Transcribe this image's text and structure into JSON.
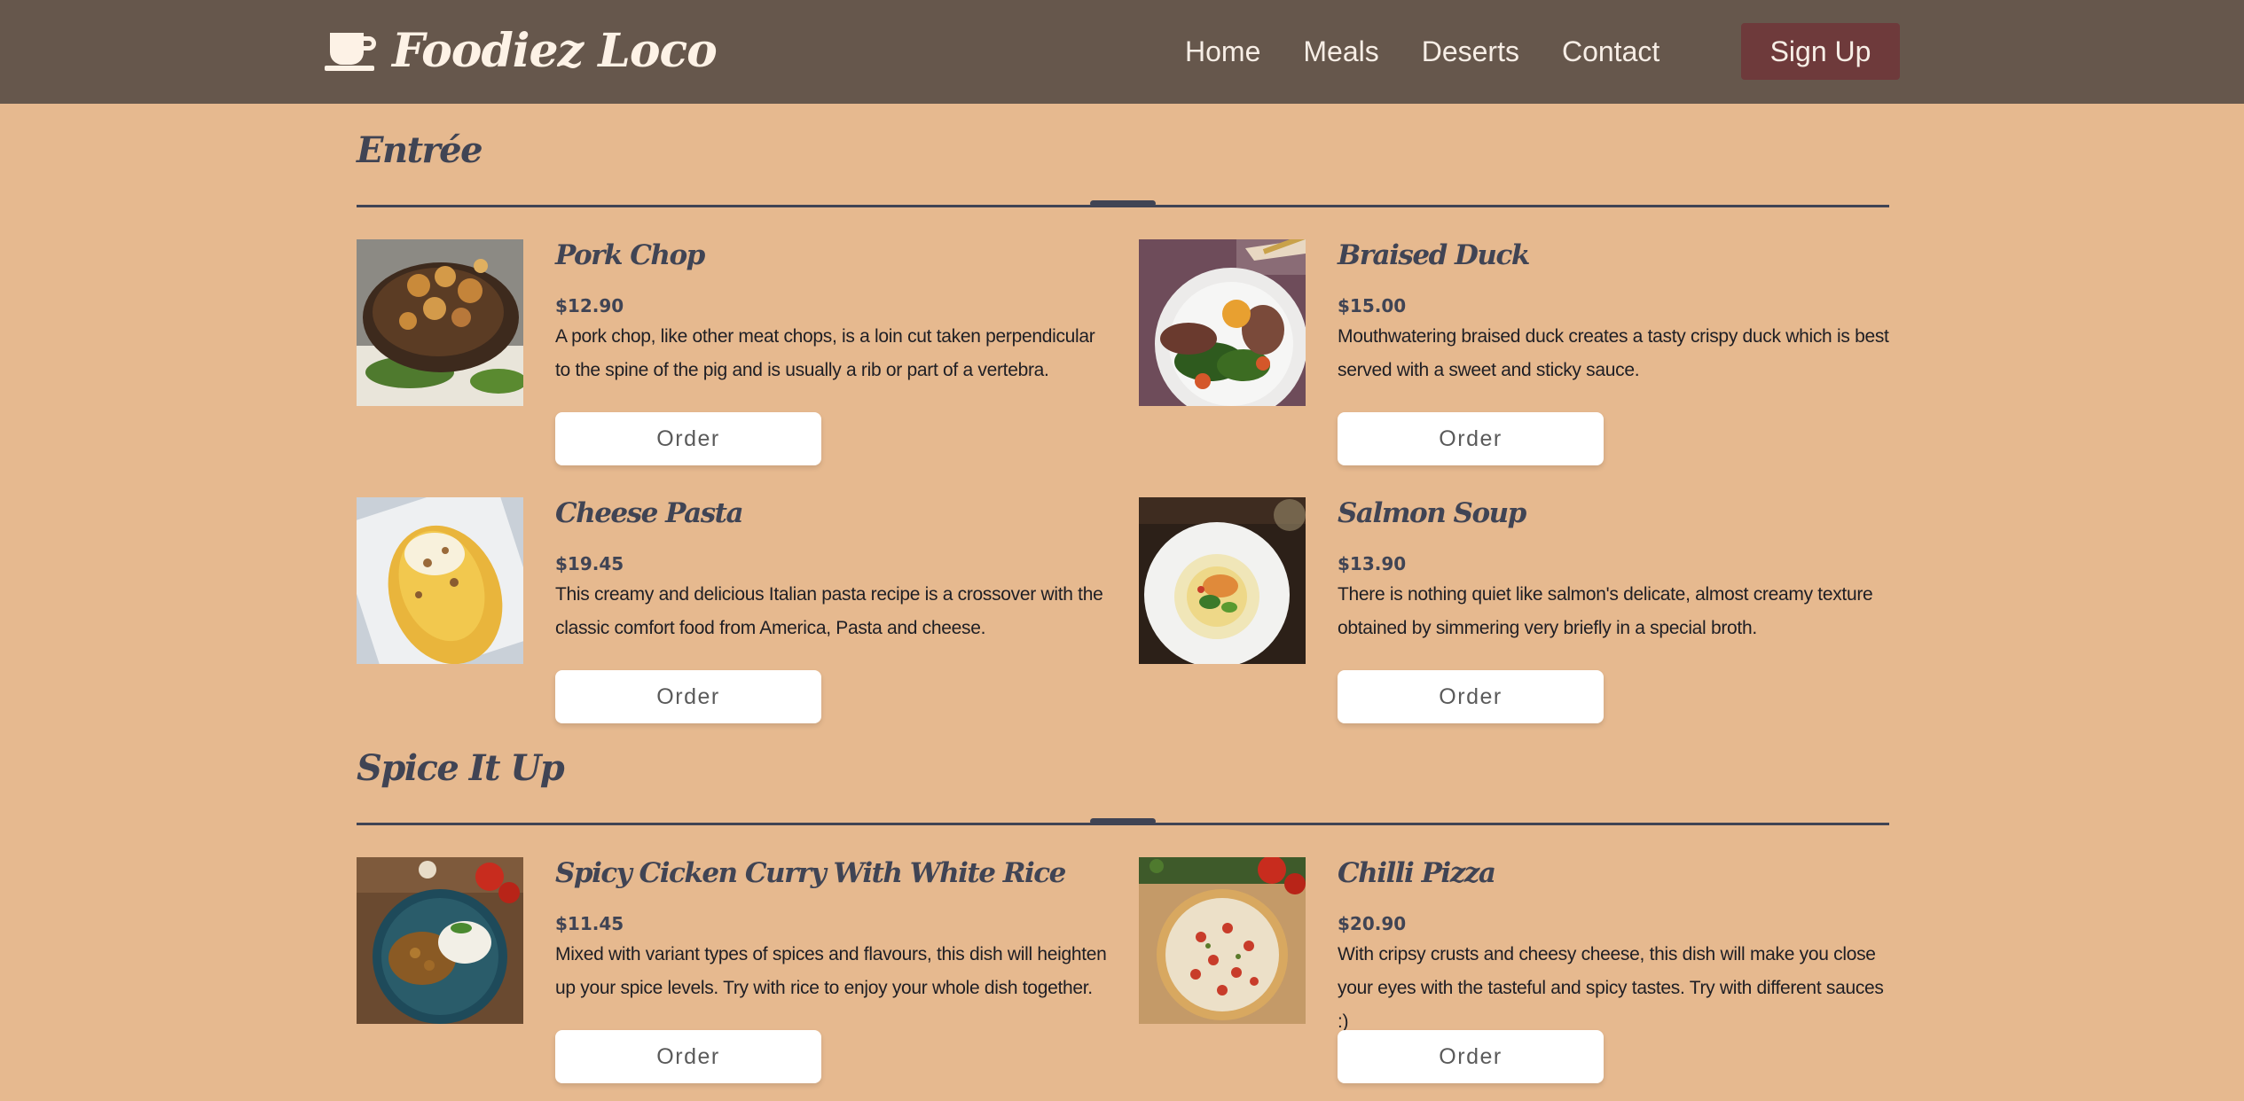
{
  "header": {
    "brand": "Foodiez Loco",
    "brand_icon": "coffee-cup-icon",
    "nav": [
      "Home",
      "Meals",
      "Deserts",
      "Contact"
    ],
    "signup_label": "Sign Up"
  },
  "colors": {
    "page_background": "#e6b98f",
    "navbar": "#66574c",
    "signup_button": "#6e3a3b",
    "heading": "#404454"
  },
  "sections": [
    {
      "title": "Entrée",
      "items": [
        {
          "name": "Pork Chop",
          "price": "$12.90",
          "description": "A pork chop, like other meat chops, is a loin cut taken perpendicular to the spine of the pig and is usually a rib or part of a vertebra.",
          "order_label": "Order"
        },
        {
          "name": "Braised Duck",
          "price": "$15.00",
          "description": "Mouthwatering braised duck creates a tasty crispy duck which is best served with a sweet and sticky sauce.",
          "order_label": "Order"
        },
        {
          "name": "Cheese Pasta",
          "price": "$19.45",
          "description": "This creamy and delicious Italian pasta recipe is a crossover with the classic comfort food from America, Pasta and cheese.",
          "order_label": "Order"
        },
        {
          "name": "Salmon Soup",
          "price": "$13.90",
          "description": "There is nothing quiet like salmon's delicate, almost creamy texture obtained by simmering very briefly in a special broth.",
          "order_label": "Order"
        }
      ]
    },
    {
      "title": "Spice It Up",
      "items": [
        {
          "name": "Spicy Cicken Curry With White Rice",
          "price": "$11.45",
          "description": "Mixed with variant types of spices and flavours, this dish will heighten up your spice levels. Try with rice to enjoy your whole dish together.",
          "order_label": "Order"
        },
        {
          "name": "Chilli Pizza",
          "price": "$20.90",
          "description": "With cripsy crusts and cheesy cheese, this dish will make you close your eyes with the tasteful and spicy tastes. Try with different sauces :)",
          "order_label": "Order"
        }
      ]
    }
  ]
}
